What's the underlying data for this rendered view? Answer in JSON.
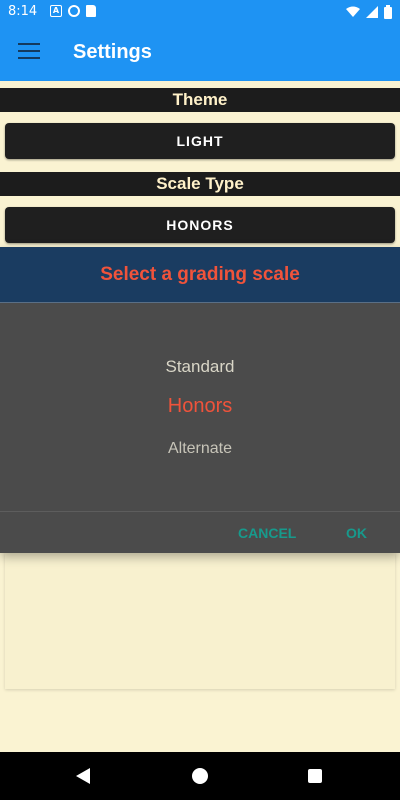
{
  "status_bar": {
    "time": "8:14",
    "icons": [
      "a-notification-icon",
      "at-sync-icon",
      "sd-card-icon",
      "wifi-icon",
      "signal-icon",
      "battery-icon"
    ],
    "a_glyph": "A"
  },
  "app_bar": {
    "title": "Settings",
    "color": "#1e93f3"
  },
  "theme": {
    "header": "Theme",
    "value": "LIGHT"
  },
  "scale_type": {
    "header": "Scale Type",
    "value": "HONORS"
  },
  "dialog": {
    "title": "Select a grading scale",
    "options": [
      "Standard",
      "Honors",
      "Alternate"
    ],
    "selected": "Honors",
    "cancel_label": "CANCEL",
    "ok_label": "OK",
    "accent": "#f0533b",
    "button_color": "#179a8c"
  },
  "background": "#faf3d2"
}
